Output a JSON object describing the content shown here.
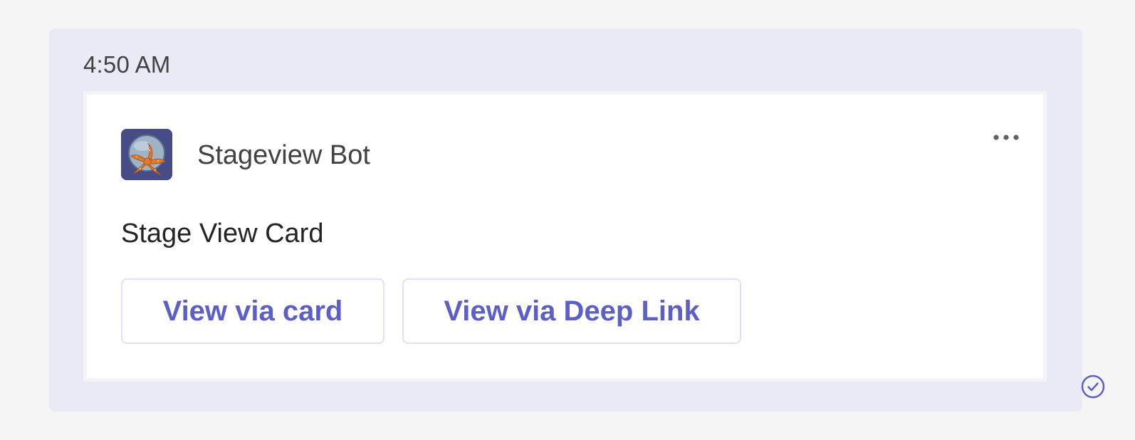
{
  "message": {
    "timestamp": "4:50 AM"
  },
  "card": {
    "bot_name": "Stageview Bot",
    "title": "Stage View Card",
    "buttons": [
      {
        "label": "View via card"
      },
      {
        "label": "View via Deep Link"
      }
    ],
    "more_icon": "more-horizontal-icon",
    "avatar_icon": "starfish-bot-avatar"
  },
  "status": {
    "icon": "checkmark-circle-icon"
  },
  "colors": {
    "page_background": "#f5f5f5",
    "bubble_background": "#e9eaf6",
    "card_background": "#ffffff",
    "accent": "#5b5fc7",
    "text_primary": "#242424",
    "text_secondary": "#424242"
  }
}
